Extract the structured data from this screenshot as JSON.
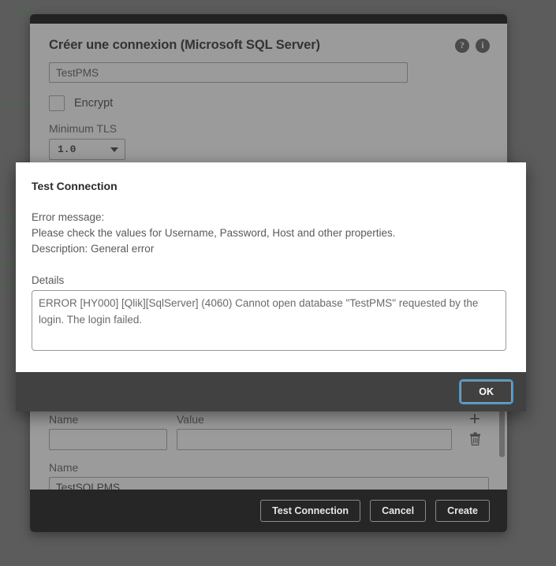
{
  "background": {
    "code_lines": [
      "  CHF';",
      "",
      "",
      "",
      "s[.ff",
      "",
      "",
      "",
      "",
      "ai;ju",
      "s;av",
      "sam",
      "jeu"
    ]
  },
  "create_connection_dialog": {
    "title": "Créer une connexion (Microsoft SQL Server)",
    "help_icon_glyph": "?",
    "info_icon_glyph": "i",
    "database_value": "TestPMS",
    "encrypt_label": "Encrypt",
    "minimum_tls_label": "Minimum TLS",
    "minimum_tls_value": "1.0",
    "properties": {
      "name_column_header": "Name",
      "value_column_header": "Value",
      "name_value": "",
      "value_value": "",
      "add_icon_glyph": "+",
      "delete_icon_name": "trash-icon"
    },
    "connection_name_label": "Name",
    "connection_name_value": "TestSQLPMS",
    "footer_buttons": {
      "test_connection": "Test Connection",
      "cancel": "Cancel",
      "create": "Create"
    }
  },
  "test_connection_modal": {
    "title": "Test Connection",
    "error_heading": "Error message:",
    "error_line_1": "Please check the values for Username, Password, Host and other properties.",
    "error_line_2": "Description: General error",
    "details_label": "Details",
    "details_value": "ERROR [HY000] [Qlik][SqlServer] (4060) Cannot open database \"TestPMS\" requested by the login. The login failed.",
    "ok_label": "OK"
  },
  "colors": {
    "dialog_background": "#9b9b9b",
    "dark_bar": "#414141",
    "footer_bar": "#262626",
    "focus_ring": "#3f9cd4",
    "modal_background": "#ffffff",
    "page_backdrop": "#5c5c5c"
  }
}
